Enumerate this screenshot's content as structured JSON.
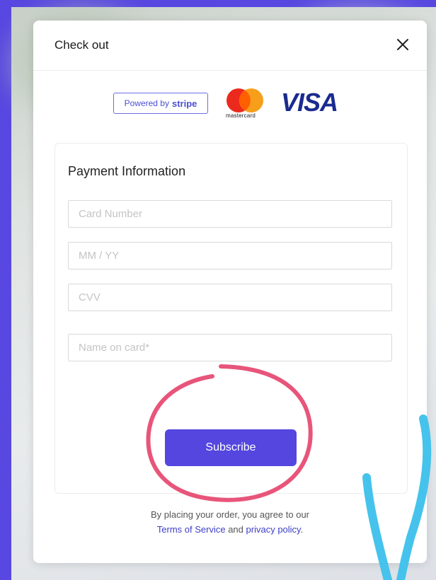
{
  "modal": {
    "title": "Check out",
    "close_icon": "close-icon"
  },
  "brand": {
    "stripe_prefix": "Powered by",
    "stripe_name": "stripe",
    "mastercard_label": "mastercard",
    "visa_label": "VISA"
  },
  "payment": {
    "section_title": "Payment Information",
    "card_number_placeholder": "Card Number",
    "expiry_placeholder": "MM / YY",
    "cvv_placeholder": "CVV",
    "name_placeholder": "Name on card*",
    "submit_label": "Subscribe"
  },
  "legal": {
    "line1": "By placing your order, you agree to our",
    "terms_link": "Terms of Service",
    "and": "and",
    "privacy_link": "privacy policy",
    "period": "."
  },
  "colors": {
    "page_background": "#5847e0",
    "accent": "#5446df",
    "annotation_circle": "#e8557a",
    "annotation_stroke": "#45c3ec"
  }
}
